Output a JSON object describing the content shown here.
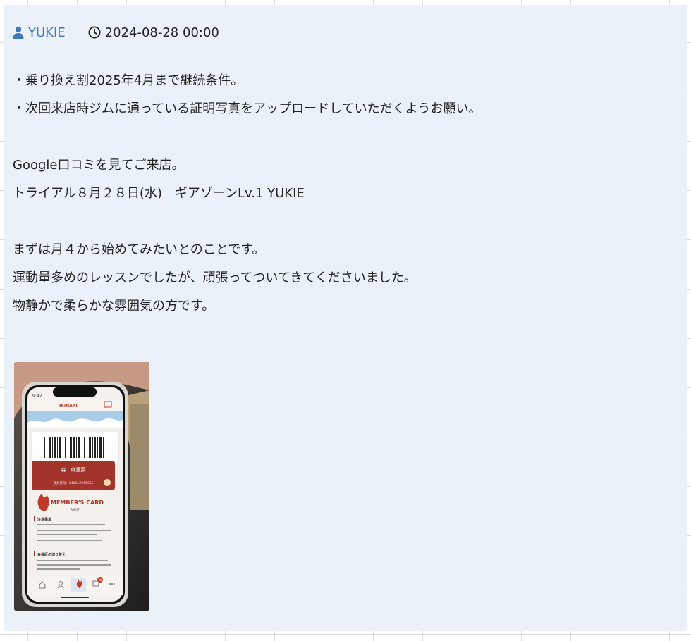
{
  "post": {
    "author": "YUKIE",
    "timestamp": "2024-08-28 00:00",
    "lines": [
      "・乗り換え割2025年4月まで継続条件。",
      "・次回来店時ジムに通っている証明写真をアップロードしていただくようお願い。",
      "",
      "Google口コミを見てご来店。",
      "トライアル８月２８日(水)　ギアゾーンLv.1 YUKIE",
      "",
      "まずは月４から始めてみたいとのことです。",
      "運動量多めのレッスンでしたが、頑張ってついてきてくださいました。",
      "物静かで柔らかな雰囲気の方です。"
    ]
  },
  "attachment": {
    "phone_time": "9:42",
    "app_name": "IKINARI",
    "card_title": "MEMBER'S CARD",
    "card_subtitle": "会員証",
    "member_name": "森　麻里菜",
    "member_number": "会員番号：840012010055",
    "notice_heading": "注意事項",
    "switch_heading": "会員証の切り替え",
    "cart_badge": "30"
  },
  "colors": {
    "card_background": "#eaf1f8",
    "author_accent": "#3f7ab8"
  }
}
